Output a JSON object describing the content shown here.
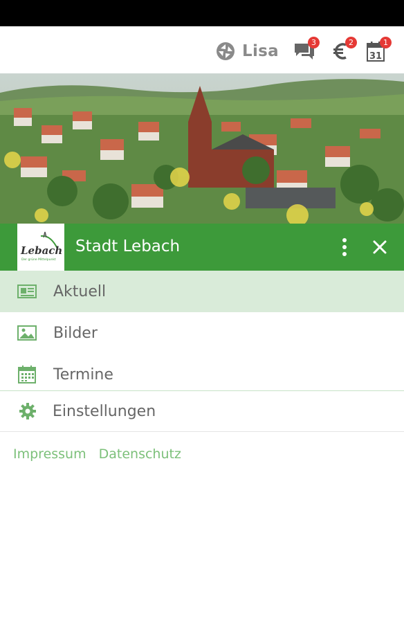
{
  "topbar": {
    "profile_name": "Lisa",
    "icons": [
      {
        "name": "messages",
        "badge": "3"
      },
      {
        "name": "euro",
        "badge": "2"
      },
      {
        "name": "calendar",
        "badge": "1",
        "day": "31"
      }
    ]
  },
  "header": {
    "title": "Stadt Lebach",
    "logo_text": "Lebach",
    "logo_tagline": "Der grüne Mittelpunkt"
  },
  "nav": {
    "items": [
      {
        "label": "Aktuell",
        "icon": "newspaper-icon",
        "active": true
      },
      {
        "label": "Bilder",
        "icon": "image-icon",
        "active": false
      },
      {
        "label": "Termine",
        "icon": "calendar-icon",
        "active": false
      }
    ],
    "settings_label": "Einstellungen"
  },
  "footer": {
    "links": [
      "Impressum",
      "Datenschutz"
    ]
  },
  "colors": {
    "accent": "#3d9a3a",
    "active_bg": "#d9ebd9",
    "link": "#7cc07a",
    "badge": "#e53935"
  }
}
